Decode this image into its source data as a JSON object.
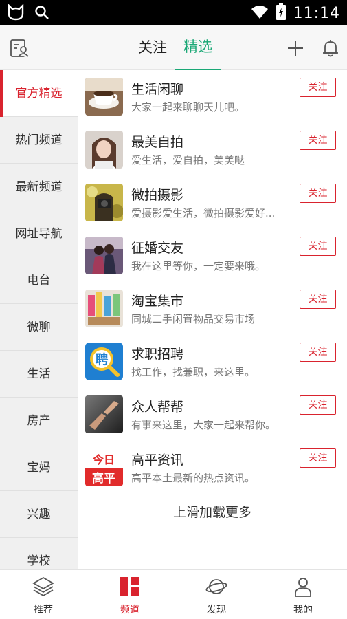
{
  "status_bar": {
    "time": "11:14",
    "icons": [
      "cat-app-icon",
      "search-icon",
      "wifi-icon",
      "battery-charging-icon"
    ]
  },
  "header": {
    "tabs": [
      {
        "label": "关注",
        "active": false
      },
      {
        "label": "精选",
        "active": true
      }
    ],
    "left_icon": "profile-card-icon",
    "right_icons": [
      "plus-icon",
      "bell-icon"
    ],
    "accent_color": "#1aa876"
  },
  "sidebar": {
    "accent_color": "#d9232e",
    "items": [
      {
        "label": "官方精选",
        "active": true
      },
      {
        "label": "热门频道",
        "active": false
      },
      {
        "label": "最新频道",
        "active": false
      },
      {
        "label": "网址导航",
        "active": false
      },
      {
        "label": "电台",
        "active": false
      },
      {
        "label": "微聊",
        "active": false
      },
      {
        "label": "生活",
        "active": false
      },
      {
        "label": "房产",
        "active": false
      },
      {
        "label": "宝妈",
        "active": false
      },
      {
        "label": "兴趣",
        "active": false
      },
      {
        "label": "学校",
        "active": false
      }
    ]
  },
  "channels": [
    {
      "title": "生活闲聊",
      "desc": "大家一起来聊聊天儿吧。",
      "button": "关注",
      "thumb": "coffee-cup-image"
    },
    {
      "title": "最美自拍",
      "desc": "爱生活，爱自拍，美美哒",
      "button": "关注",
      "thumb": "selfie-girl-image"
    },
    {
      "title": "微拍摄影",
      "desc": "爱摄影爱生活，微拍摄影爱好...",
      "button": "关注",
      "thumb": "camera-photographer-image"
    },
    {
      "title": "征婚交友",
      "desc": "我在这里等你，一定要来哦。",
      "button": "关注",
      "thumb": "couple-image"
    },
    {
      "title": "淘宝集市",
      "desc": "同城二手闲置物品交易市场",
      "button": "关注",
      "thumb": "market-goods-image"
    },
    {
      "title": "求职招聘",
      "desc": "找工作，找兼职，来这里。",
      "button": "关注",
      "thumb": "recruitment-magnifier-icon"
    },
    {
      "title": "众人帮帮",
      "desc": "有事来这里，大家一起来帮你。",
      "button": "关注",
      "thumb": "helping-hand-image"
    },
    {
      "title": "高平资讯",
      "desc": "高平本土最新的热点资讯。",
      "button": "关注",
      "thumb": "gaoping-news-logo"
    }
  ],
  "load_more": "上滑加载更多",
  "bottom_nav": {
    "items": [
      {
        "label": "推荐",
        "icon": "layers-icon",
        "active": false
      },
      {
        "label": "频道",
        "icon": "channel-grid-icon",
        "active": true
      },
      {
        "label": "发现",
        "icon": "planet-icon",
        "active": false
      },
      {
        "label": "我的",
        "icon": "person-icon",
        "active": false
      }
    ]
  },
  "thumb_texts": {
    "recruit": "聘",
    "gaoping_top": "今日",
    "gaoping_bottom": "高平"
  }
}
